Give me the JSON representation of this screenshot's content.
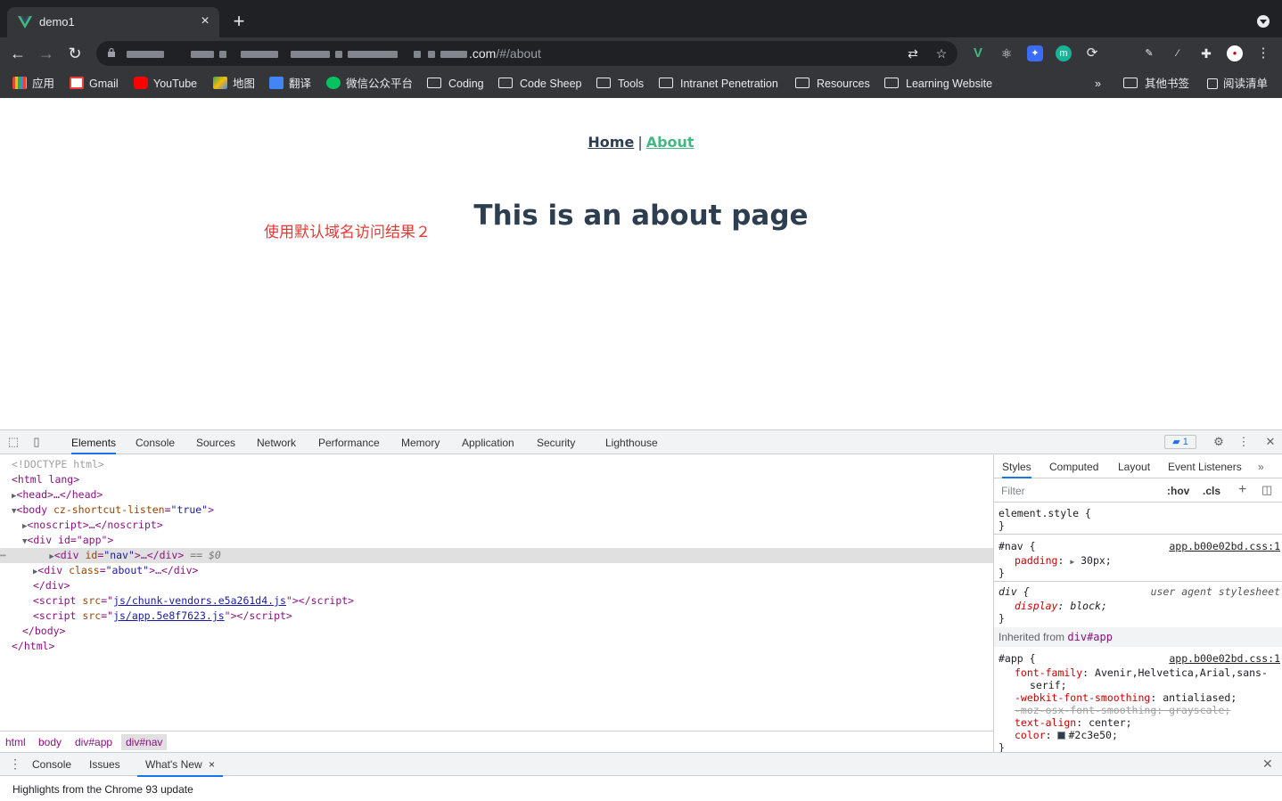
{
  "browser": {
    "tab_title": "demo1",
    "url_domain_suffix": ".com",
    "url_path": "/#/about",
    "new_tab_icon": "plus-icon",
    "close_icon": "close-icon"
  },
  "bookmarks": [
    {
      "label": "应用",
      "icon": "apps-grid-icon",
      "color": "#4285f4"
    },
    {
      "label": "Gmail",
      "icon": "gmail-icon",
      "color": "#ea4335"
    },
    {
      "label": "YouTube",
      "icon": "youtube-icon",
      "color": "#ff0000"
    },
    {
      "label": "地图",
      "icon": "maps-icon",
      "color": "#34a853"
    },
    {
      "label": "翻译",
      "icon": "translate-icon",
      "color": "#4285f4"
    },
    {
      "label": "微信公众平台",
      "icon": "wechat-icon",
      "color": "#07c160"
    },
    {
      "label": "Coding",
      "icon": "folder-icon"
    },
    {
      "label": "Code Sheep",
      "icon": "folder-icon"
    },
    {
      "label": "Tools",
      "icon": "folder-icon"
    },
    {
      "label": "Intranet Penetration",
      "icon": "folder-icon"
    },
    {
      "label": "Resources",
      "icon": "folder-icon"
    },
    {
      "label": "Learning Website",
      "icon": "folder-icon"
    }
  ],
  "bookmarks_right": {
    "more": "»",
    "other": "其他书签",
    "reading_list": "阅读清单"
  },
  "page": {
    "nav_home": "Home",
    "nav_sep": "|",
    "nav_about": "About",
    "heading": "This is an about page",
    "annotation": "使用默认域名访问结果２",
    "colors": {
      "text": "#2c3e50",
      "active_link": "#42b983",
      "annotation": "#e53935"
    }
  },
  "devtools": {
    "tabs": [
      "Elements",
      "Console",
      "Sources",
      "Network",
      "Performance",
      "Memory",
      "Application",
      "Security",
      "Lighthouse"
    ],
    "issues_badge": "1",
    "dom": {
      "doctype": "<!DOCTYPE html>",
      "html_open": "<html lang>",
      "head": "<head>…</head>",
      "body_tag": "<body",
      "body_attr": "cz-shortcut-listen",
      "body_attr_val": "\"true\"",
      "noscript": "<noscript>…</noscript>",
      "app_open": "<div id=\"app\">",
      "nav_div_tag": "<div",
      "nav_div_attr": "id",
      "nav_div_val": "\"nav\"",
      "nav_div_close": ">…</div>",
      "selected_marker": "== $0",
      "about_div_tag": "<div",
      "about_div_attr": "class",
      "about_div_val": "\"about\"",
      "about_div_close": ">…</div>",
      "app_close": "</div>",
      "script1_src": "js/chunk-vendors.e5a261d4.js",
      "script2_src": "js/app.5e8f7623.js",
      "body_close": "</body>",
      "html_close": "</html>"
    },
    "breadcrumb": [
      "html",
      "body",
      "div#app",
      "div#nav"
    ],
    "styles_tabs": [
      "Styles",
      "Computed",
      "Layout",
      "Event Listeners"
    ],
    "filter_placeholder": "Filter",
    "hov": ":hov",
    "cls": ".cls",
    "rules": {
      "element_style": "element.style {",
      "nav_selector": "#nav {",
      "nav_src": "app.b00e02bd.css:1",
      "nav_padding_prop": "padding",
      "nav_padding_val": "30px;",
      "div_selector": "div {",
      "div_src": "user agent stylesheet",
      "div_display_prop": "display",
      "div_display_val": "block;",
      "inherited_label": "Inherited from",
      "inherited_from": "div#app",
      "app_selector": "#app {",
      "app_src": "app.b00e02bd.css:1",
      "font_family_prop": "font-family",
      "font_family_val": "Avenir,Helvetica,Arial,sans-",
      "font_family_val2": "serif;",
      "smoothing_prop": "-webkit-font-smoothing",
      "smoothing_val": "antialiased;",
      "moz_prop": "-moz-osx-font-smoothing: grayscale;",
      "text_align_prop": "text-align",
      "text_align_val": "center;",
      "color_prop": "color",
      "color_val": "#2c3e50;",
      "close_brace": "}"
    },
    "drawer_tabs": [
      "Console",
      "Issues",
      "What's New"
    ],
    "drawer_text": "Highlights from the Chrome 93 update"
  }
}
